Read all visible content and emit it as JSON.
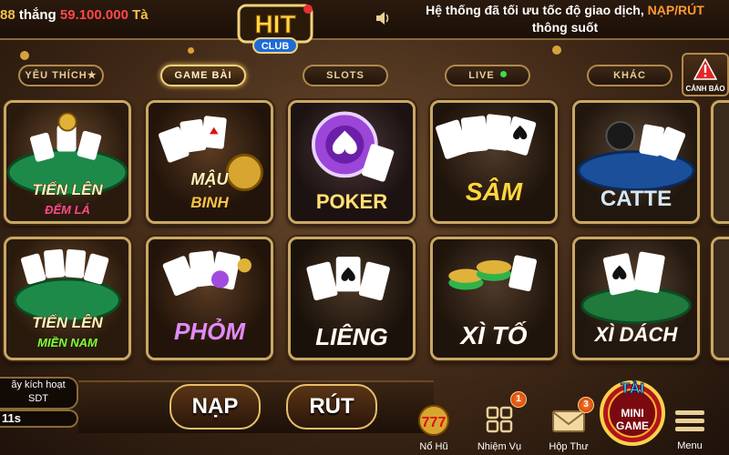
{
  "ticker": {
    "prefix": "88",
    "word": "thắng",
    "amount": "59.100.000",
    "tail": "Tà"
  },
  "logo": {
    "top": "HIT",
    "bottom": "CLUB"
  },
  "notice": {
    "line1_a": "Hệ thống đã tối ưu tốc độ giao dịch,",
    "line1_b": "NẠP/RÚT",
    "line2": "thông suốt"
  },
  "tabs": [
    {
      "label": "YÊU THÍCH★"
    },
    {
      "label": "GAME BÀI"
    },
    {
      "label": "SLOTS"
    },
    {
      "label": "LIVE"
    },
    {
      "label": "KHÁC"
    }
  ],
  "warning": {
    "label": "CẢNH BÁO"
  },
  "games": [
    {
      "title": "TIẾN LÊN",
      "sub": "ĐẾM LÁ"
    },
    {
      "title": "MẬU",
      "sub": "BINH"
    },
    {
      "title": "POKER",
      "sub": ""
    },
    {
      "title": "SÂM",
      "sub": ""
    },
    {
      "title": "CATTE",
      "sub": ""
    },
    {
      "title": "TIẾN LÊN",
      "sub": "MIỀN NAM"
    },
    {
      "title": "PHỎM",
      "sub": ""
    },
    {
      "title": "LIÊNG",
      "sub": ""
    },
    {
      "title": "XÌ TỐ",
      "sub": ""
    },
    {
      "title": "XÌ DÁCH",
      "sub": ""
    }
  ],
  "sdt": {
    "line1": "ãy kích hoạt",
    "line2": "SDT"
  },
  "timer": "11s",
  "buttons": {
    "nap": "NẠP",
    "rut": "RÚT"
  },
  "bottom_icons": [
    {
      "label": "Nổ Hũ",
      "badge": ""
    },
    {
      "label": "Nhiệm Vụ",
      "badge": "1"
    },
    {
      "label": "Hộp Thư",
      "badge": "3"
    }
  ],
  "minigame": {
    "top": "TÀI",
    "line1": "MINI",
    "line2": "GAME"
  },
  "menu": {
    "label": "Menu"
  },
  "colors": {
    "gold": "#f3c14b",
    "accent_red": "#ff4848",
    "orange": "#ff9b2f"
  }
}
